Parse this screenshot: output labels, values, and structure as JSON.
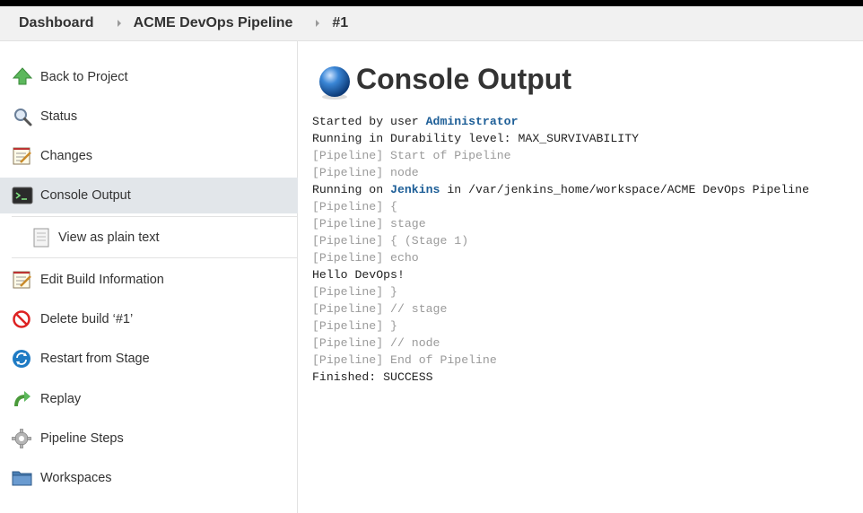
{
  "breadcrumb": {
    "items": [
      "Dashboard",
      "ACME DevOps Pipeline",
      "#1"
    ]
  },
  "sidebar": {
    "items": [
      {
        "label": "Back to Project",
        "icon": "up-arrow-icon"
      },
      {
        "label": "Status",
        "icon": "magnifier-icon"
      },
      {
        "label": "Changes",
        "icon": "notepad-icon"
      },
      {
        "label": "Console Output",
        "icon": "terminal-icon",
        "active": true
      },
      {
        "label": "View as plain text",
        "icon": "document-icon"
      },
      {
        "label": "Edit Build Information",
        "icon": "notepad-icon"
      },
      {
        "label": "Delete build ‘#1’",
        "icon": "no-entry-icon"
      },
      {
        "label": "Restart from Stage",
        "icon": "refresh-icon"
      },
      {
        "label": "Replay",
        "icon": "replay-arrow-icon"
      },
      {
        "label": "Pipeline Steps",
        "icon": "gear-icon"
      },
      {
        "label": "Workspaces",
        "icon": "folder-icon"
      }
    ]
  },
  "main": {
    "title": "Console Output",
    "title_icon": "blue-ball-icon",
    "console": {
      "started_by_prefix": "Started by user ",
      "started_by_user": "Administrator",
      "durability": "Running in Durability level: MAX_SURVIVABILITY",
      "start_pipeline": "[Pipeline] Start of Pipeline",
      "node": "[Pipeline] node",
      "running_on_prefix": "Running on ",
      "running_on_node": "Jenkins",
      "running_on_suffix": " in /var/jenkins_home/workspace/ACME DevOps Pipeline",
      "brace_open": "[Pipeline] {",
      "stage": "[Pipeline] stage",
      "stage1": "[Pipeline] { (Stage 1)",
      "echo": "[Pipeline] echo",
      "hello": "Hello DevOps!",
      "brace_close1": "[Pipeline] }",
      "end_stage": "[Pipeline] // stage",
      "brace_close2": "[Pipeline] }",
      "end_node": "[Pipeline] // node",
      "end_pipeline": "[Pipeline] End of Pipeline",
      "finished": "Finished: SUCCESS"
    }
  },
  "colors": {
    "link": "#1d5e97",
    "dim_text": "#9a9a9a",
    "active_bg": "#e2e6ea",
    "breadcrumb_bg": "#f1f1f1"
  }
}
